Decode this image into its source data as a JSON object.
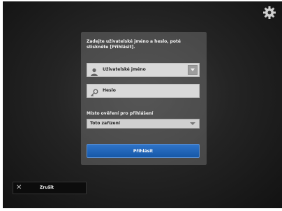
{
  "prompt": "Zadejte uživatelské jméno a heslo, poté stiskněte [Přihlásit].",
  "username": {
    "placeholder": "Uživatelské jméno",
    "icon": "user-icon"
  },
  "password": {
    "placeholder": "Heslo",
    "icon": "key-icon"
  },
  "domain": {
    "label": "Místo ověření pro přihlášení",
    "value": "Toto zařízení"
  },
  "login_button": "Přihlásit",
  "cancel_button": "Zrušit",
  "colors": {
    "accent": "#1f66bd",
    "panel": "#5a5a5a"
  }
}
